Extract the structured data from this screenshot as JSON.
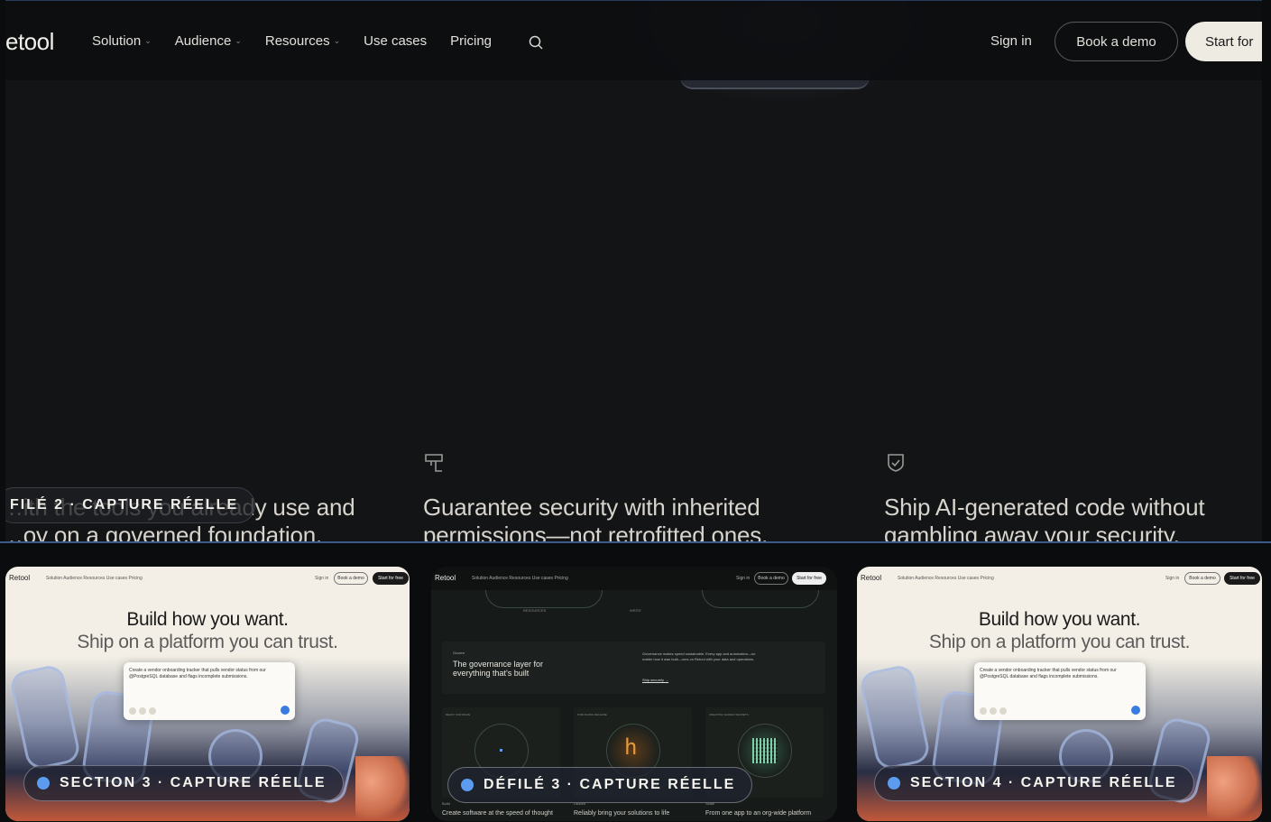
{
  "nav": {
    "logo": "etool",
    "menu": [
      {
        "label": "Solution",
        "has_dropdown": true
      },
      {
        "label": "Audience",
        "has_dropdown": true
      },
      {
        "label": "Resources",
        "has_dropdown": true
      },
      {
        "label": "Use cases",
        "has_dropdown": false
      },
      {
        "label": "Pricing",
        "has_dropdown": false
      }
    ],
    "search_icon": "search-icon",
    "sign_in": "Sign in",
    "book_demo": "Book a demo",
    "start": "Start for"
  },
  "features": [
    {
      "icon": "shield-check-icon",
      "line1": "…ith the tools you already use and",
      "line2": "…oy on a governed foundation."
    },
    {
      "icon": "window-icon",
      "line1": "Guarantee security with inherited",
      "line2": "permissions—not retrofitted ones."
    },
    {
      "icon": "shield-check-icon",
      "line1": "Ship AI-generated code without",
      "line2": "gambling away your security."
    }
  ],
  "main_tag": "FILÉ 2 · CAPTURE RÉELLE",
  "thumbs": [
    {
      "nav": {
        "logo": "Retool",
        "menu": "Solution   Audience   Resources   Use cases   Pricing",
        "sign_in": "Sign in",
        "book_demo": "Book a demo",
        "start": "Start for free"
      },
      "hero_line1": "Build how you want.",
      "hero_line2": "Ship on a platform you can trust.",
      "prompt": "Create a vendor onboarding tracker that pulls vendor status from our @PostgreSQL database and flags incomplete submissions.",
      "tag": "SECTION 3 · CAPTURE RÉELLE"
    },
    {
      "nav": {
        "logo": "Retool",
        "menu": "Solution   Audience   Resources   Use cases   Pricing",
        "sign_in": "Sign in",
        "book_demo": "Book a demo",
        "start": "Start for free"
      },
      "resources": "RESOURCES",
      "write": "WRITE",
      "gov_label": "Govern",
      "gov_title": "The governance layer for everything that's built",
      "gov_body": "Governance makes speed sustainable. Every app and automation—no matter how it was built—runs on Retool with your data and operations.",
      "gov_link": "Ship securely →",
      "panels": [
        "READY FOR REVIE",
        "PUBLISHING RELEASE",
        "CREATING SHARED SECRETS"
      ],
      "bottom": [
        {
          "label": "Build",
          "text": "Create software at the speed of thought"
        },
        {
          "label": "Launch",
          "text": "Reliably bring your solutions to life"
        },
        {
          "label": "Scale",
          "text": "From one app to an org-wide platform"
        }
      ],
      "tag": "DÉFILÉ 3 · CAPTURE RÉELLE"
    },
    {
      "nav": {
        "logo": "Retool",
        "menu": "Solution   Audience   Resources   Use cases   Pricing",
        "sign_in": "Sign in",
        "book_demo": "Book a demo",
        "start": "Start for free"
      },
      "hero_line1": "Build how you want.",
      "hero_line2": "Ship on a platform you can trust.",
      "prompt": "Create a vendor onboarding tracker that pulls vendor status from our @PostgreSQL database and flags incomplete submissions.",
      "tag": "SECTION 4 · CAPTURE RÉELLE"
    }
  ],
  "colors": {
    "accent_dot": "#5b9cf0",
    "divider": "#3a5a8c",
    "cream": "#f3efe6"
  }
}
